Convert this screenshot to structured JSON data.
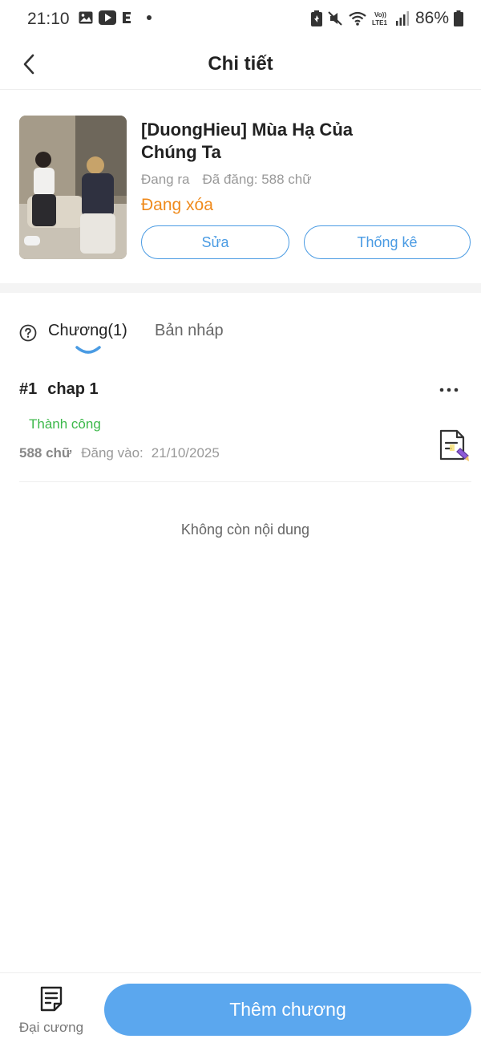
{
  "status_bar": {
    "time": "21:10",
    "battery": "86%",
    "left_icons": [
      "gallery-icon",
      "youtube-icon",
      "e-icon",
      "dot-icon"
    ],
    "right_icons": [
      "battery-saver-icon",
      "mute-icon",
      "wifi-icon",
      "volte-icon",
      "signal-icon",
      "battery-icon"
    ]
  },
  "header": {
    "title": "Chi tiết"
  },
  "book": {
    "title": "[DuongHieu] Mùa Hạ Của Chúng Ta",
    "state": "Đang ra",
    "published": "Đã đăng: 588 chữ",
    "status": "Đang xóa",
    "edit_label": "Sửa",
    "stats_label": "Thống kê"
  },
  "tabs": {
    "chapters": "Chương(1)",
    "drafts": "Bản nháp"
  },
  "chapters": [
    {
      "number": "#1",
      "name": "chap 1",
      "status": "Thành công",
      "words": "588 chữ",
      "posted_label": "Đăng vào:",
      "date": "21/10/2025"
    }
  ],
  "empty_message": "Không còn nội dung",
  "bottom": {
    "outline_label": "Đại cương",
    "add_chapter_label": "Thêm chương"
  },
  "colors": {
    "accent": "#4a9be3",
    "primary_button": "#5ba7ee",
    "status_deleting": "#ef8a1c",
    "status_success": "#3cb84a"
  }
}
